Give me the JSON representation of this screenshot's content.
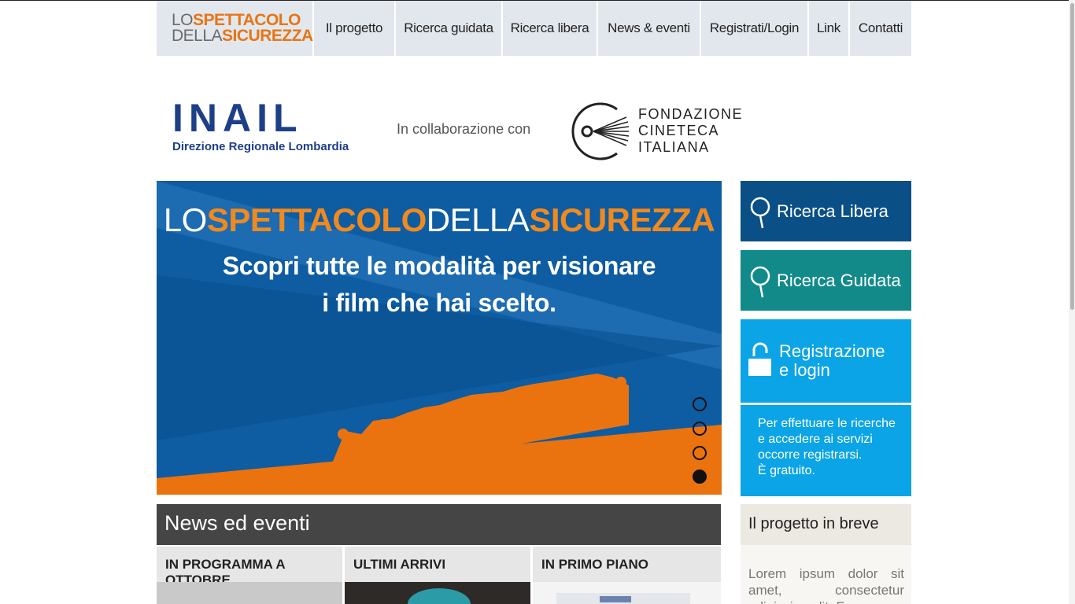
{
  "logo": {
    "line1_light": "LO",
    "line1_bold": "SPETTACOLO",
    "line2_light": "DELLA",
    "line2_bold": "SICUREZZA"
  },
  "nav": {
    "items": [
      {
        "label": "Il progetto"
      },
      {
        "label": "Ricerca guidata"
      },
      {
        "label": "Ricerca libera"
      },
      {
        "label": "News & eventi"
      },
      {
        "label": "Registrati/Login"
      },
      {
        "label": "Link"
      },
      {
        "label": "Contatti"
      }
    ]
  },
  "partners": {
    "inail_word": "INAIL",
    "inail_sub": "Direzione Regionale Lombardia",
    "collab": "In collaborazione con",
    "cineteca_line1": "FONDAZIONE",
    "cineteca_line2": "CINETECA",
    "cineteca_line3": "ITALIANA"
  },
  "hero": {
    "brand_1": "LO",
    "brand_2": "SPETTACOLO",
    "brand_3": "DELLA",
    "brand_4": "SICUREZZA",
    "line1": "Scopri tutte le modalità per visionare",
    "line2": "i film che hai scelto.",
    "slide_count": 4,
    "active_slide": 4
  },
  "side": {
    "ricerca_libera": "Ricerca Libera",
    "ricerca_guidata": "Ricerca Guidata",
    "registrazione_1": "Registrazione",
    "registrazione_2": "e login",
    "info_1": "Per effettuare le ricerche",
    "info_2": "e accedere ai servizi",
    "info_3": "occorre registrarsi.",
    "info_4": "È gratuito."
  },
  "news": {
    "title": "News ed eventi",
    "tabs": [
      {
        "label": "IN PROGRAMMA A OTTOBRE"
      },
      {
        "label": "ULTIMI ARRIVI"
      },
      {
        "label": "IN PRIMO PIANO"
      }
    ]
  },
  "project": {
    "title": "Il progetto in breve",
    "text": "Lorem ipsum dolor sit amet, consectetur adipiscing elit. Fusce"
  },
  "colors": {
    "nav_bg": "#e2e7ee",
    "orange": "#e87511",
    "hero_blue": "#0d5aa0",
    "btn_libera": "#0a4f86",
    "btn_guidata": "#138a8a",
    "btn_login": "#0ba4e6",
    "news_head": "#454545"
  }
}
